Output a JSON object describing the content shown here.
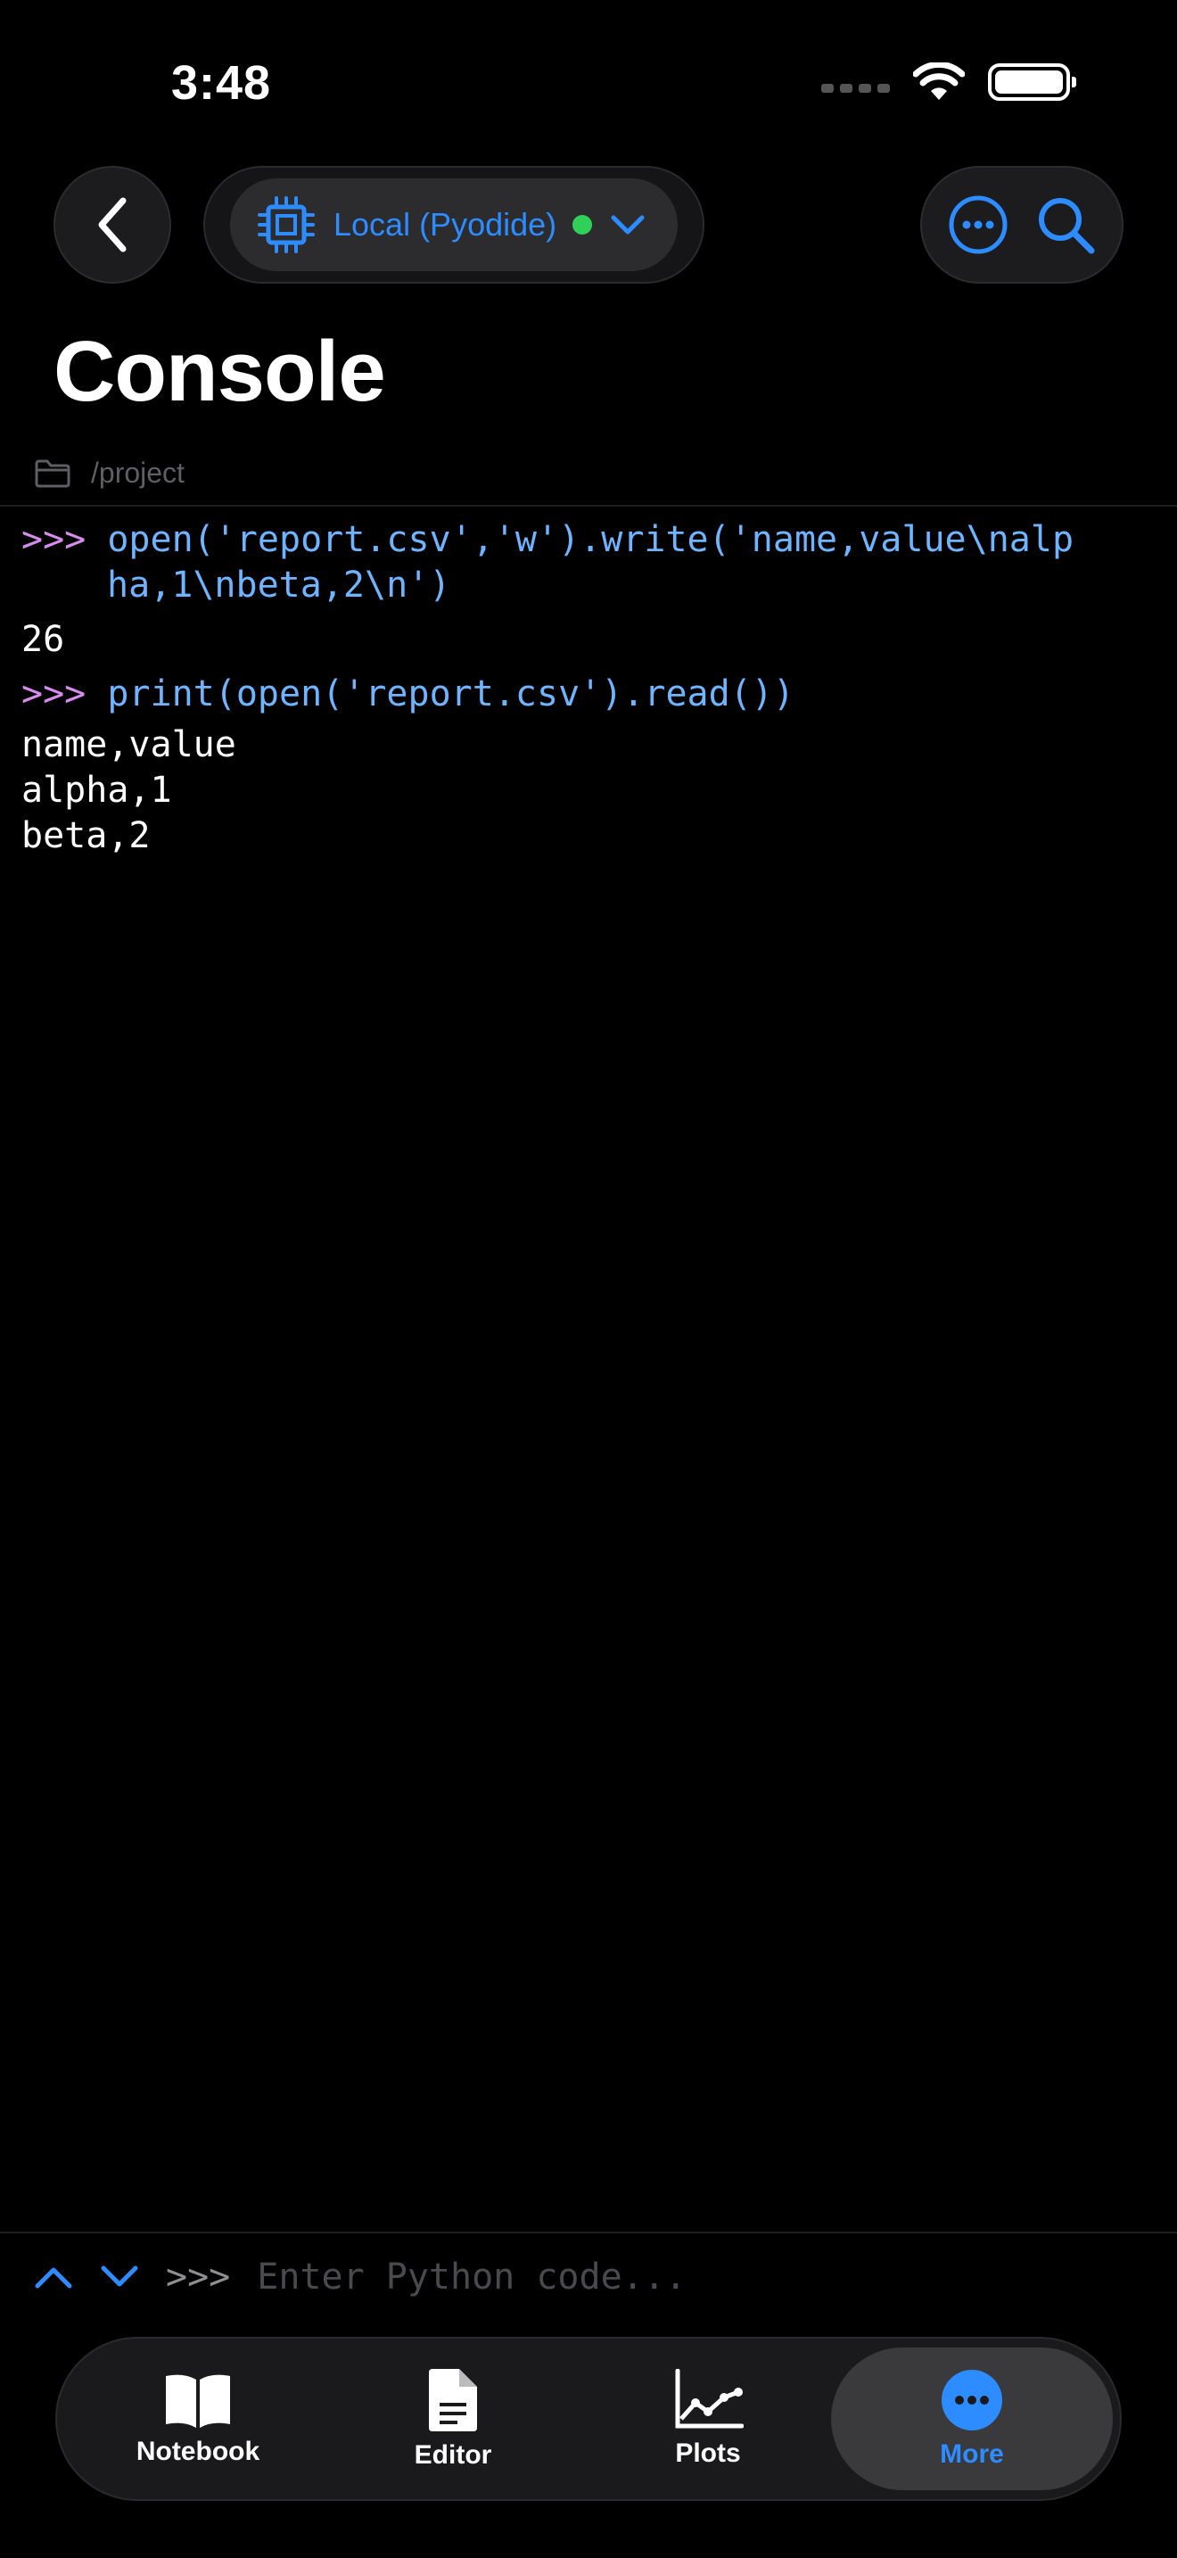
{
  "status_bar": {
    "time": "3:48"
  },
  "nav": {
    "kernel_label": "Local (Pyodide)",
    "title": "Console"
  },
  "path": "/project",
  "console": {
    "prompt": ">>>",
    "lines": [
      {
        "type": "input",
        "prompt": ">>>",
        "text": "open('report.csv','w').write('name,value\\nalp"
      },
      {
        "type": "cont",
        "text": "ha,1\\nbeta,2\\n')"
      },
      {
        "type": "output",
        "text": "26"
      },
      {
        "type": "input",
        "prompt": ">>>",
        "text": "print(open('report.csv').read())"
      },
      {
        "type": "output",
        "text": "name,value"
      },
      {
        "type": "output",
        "text": "alpha,1"
      },
      {
        "type": "output",
        "text": "beta,2"
      }
    ]
  },
  "input": {
    "prompt": ">>>",
    "placeholder": "Enter Python code...",
    "value": ""
  },
  "tabs": [
    {
      "label": "Notebook",
      "icon": "book-icon",
      "active": false
    },
    {
      "label": "Editor",
      "icon": "document-icon",
      "active": false
    },
    {
      "label": "Plots",
      "icon": "chart-icon",
      "active": false
    },
    {
      "label": "More",
      "icon": "more-icon",
      "active": true
    }
  ],
  "colors": {
    "accent": "#2d8cff",
    "prompt": "#d98cf0",
    "code": "#6eb4ff",
    "status_dot": "#30d158"
  }
}
